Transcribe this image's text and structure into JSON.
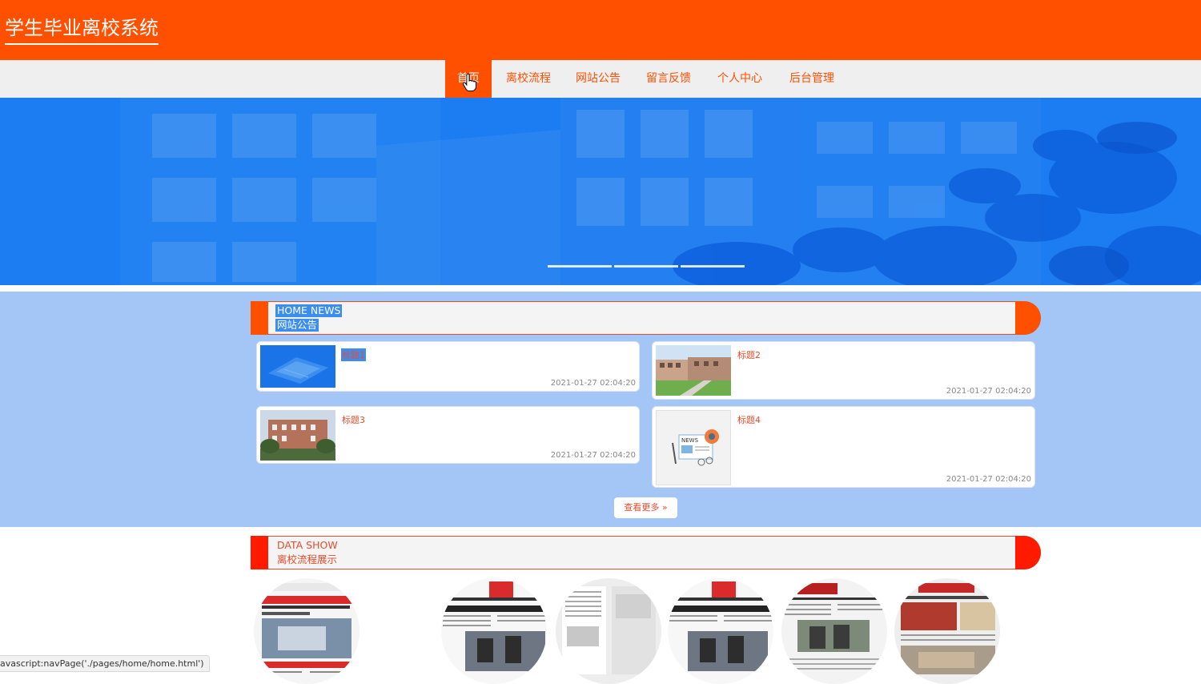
{
  "header": {
    "title": "学生毕业离校系统",
    "bg_color": "#ff5000"
  },
  "nav": {
    "items": [
      {
        "label": "首页",
        "active": true
      },
      {
        "label": "离校流程"
      },
      {
        "label": "网站公告"
      },
      {
        "label": "留言反馈"
      },
      {
        "label": "个人中心"
      },
      {
        "label": "后台管理"
      }
    ]
  },
  "banner": {
    "slides": 3,
    "active_slide": 1
  },
  "news": {
    "heading_en": "HOME NEWS",
    "heading_cn": "网站公告",
    "cards": [
      {
        "title": "标题1",
        "date": "2021-01-27 02:04:20",
        "thumb": "campus-aerial-blue"
      },
      {
        "title": "标题2",
        "date": "2021-01-27 02:04:20",
        "thumb": "campus-building-lawn"
      },
      {
        "title": "标题3",
        "date": "2021-01-27 02:04:20",
        "thumb": "campus-building-trees"
      },
      {
        "title": "标题4",
        "date": "2021-01-27 02:04:20",
        "thumb": "news-icon"
      }
    ],
    "more_label": "查看更多 »"
  },
  "data_show": {
    "heading_en": "DATA SHOW",
    "heading_cn": "离校流程展示",
    "items": [
      {
        "kind": "newspaper-front-1"
      },
      {
        "kind": "newspaper-front-2"
      },
      {
        "kind": "newspaper-grey"
      },
      {
        "kind": "newspaper-front-2"
      },
      {
        "kind": "newspaper-front-3"
      },
      {
        "kind": "newspaper-front-4"
      }
    ]
  },
  "status_bar": {
    "text": "avascript:navPage('./pages/home/home.html')"
  },
  "colors": {
    "accent": "#ff5000",
    "news_bg": "#a3c6f7",
    "banner": "#1a7bf0",
    "title_red": "#e94b2c"
  }
}
